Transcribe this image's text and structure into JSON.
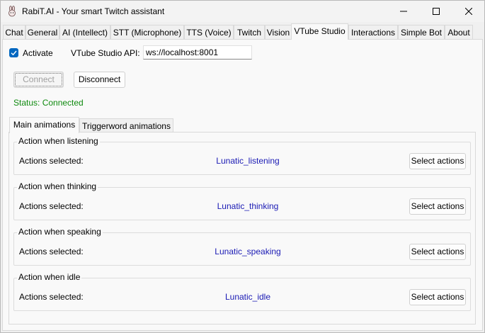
{
  "window": {
    "title": "RabiT.AI - Your smart Twitch assistant"
  },
  "tabs": [
    {
      "label": "Chat"
    },
    {
      "label": "General"
    },
    {
      "label": "AI (Intellect)"
    },
    {
      "label": "STT (Microphone)"
    },
    {
      "label": "TTS (Voice)"
    },
    {
      "label": "Twitch"
    },
    {
      "label": "Vision"
    },
    {
      "label": "VTube Studio"
    },
    {
      "label": "Interactions"
    },
    {
      "label": "Simple Bot"
    },
    {
      "label": "About"
    }
  ],
  "vtube": {
    "activate_label": "Activate",
    "api_label": "VTube Studio API:",
    "api_value": "ws://localhost:8001",
    "connect_label": "Connect",
    "disconnect_label": "Disconnect",
    "status": "Status: Connected"
  },
  "subtabs": [
    {
      "label": "Main animations"
    },
    {
      "label": "Triggerword animations"
    }
  ],
  "groups": [
    {
      "title": "Action when listening",
      "label": "Actions selected:",
      "value": "Lunatic_listening",
      "button": "Select actions"
    },
    {
      "title": "Action when thinking",
      "label": "Actions selected:",
      "value": "Lunatic_thinking",
      "button": "Select actions"
    },
    {
      "title": "Action when speaking",
      "label": "Actions selected:",
      "value": "Lunatic_speaking",
      "button": "Select actions"
    },
    {
      "title": "Action when idle",
      "label": "Actions selected:",
      "value": "Lunatic_idle",
      "button": "Select actions"
    }
  ],
  "colors": {
    "status_connected": "#0f8a0f",
    "action_value": "#1a1ab4",
    "checkbox_accent": "#0067c0"
  }
}
